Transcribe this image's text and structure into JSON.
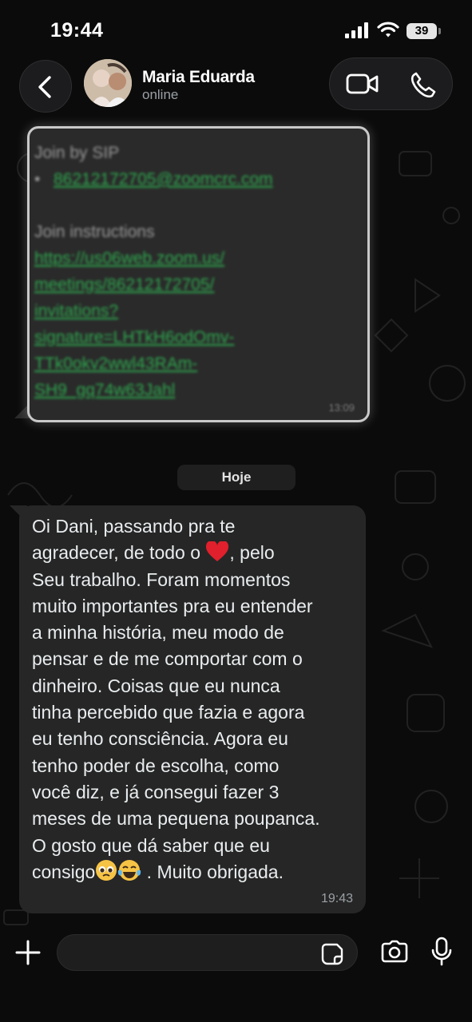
{
  "status_bar": {
    "time": "19:44",
    "battery": "39"
  },
  "header": {
    "contact_name": "Maria Eduarda",
    "contact_status": "online"
  },
  "earlier_message": {
    "label_sip": "Join by SIP",
    "sip_address": "86212172705@zoomcrc.com",
    "label_instructions": "Join instructions",
    "link_lines": [
      "https://us06web.zoom.us/",
      "meetings/86212172705/",
      "invitations?",
      "signature=LHTkH6odOmv-",
      "TTk0okv2wwl43RAm-",
      "SH9_gq74w63Jahl"
    ],
    "time": "13:09",
    "obscured": true
  },
  "date_divider": "Hoje",
  "message": {
    "lines": [
      "Oi Dani, passando pra te",
      "agradecer, de todo o ",
      ", pelo",
      "Seu trabalho. Foram momentos",
      "muito importantes pra eu entender",
      "a minha história, meu modo de",
      "pensar e de me comportar com o",
      "dinheiro. Coisas que eu nunca",
      "tinha percebido que fazia e agora",
      "eu tenho consciência. Agora eu",
      "tenho poder de escolha, como",
      "você diz, e já consegui fazer 3",
      "meses de uma pequena poupanca.",
      "O gosto que dá saber que eu",
      "consigo",
      " . Muito obrigada."
    ],
    "emojis": [
      "red-heart",
      "pleading-face",
      "tears-of-joy"
    ],
    "time": "19:43"
  },
  "colors": {
    "background": "#0b0b0b",
    "bubble": "#262626",
    "link_green": "#2fa84f",
    "heart": "#e0202c"
  }
}
